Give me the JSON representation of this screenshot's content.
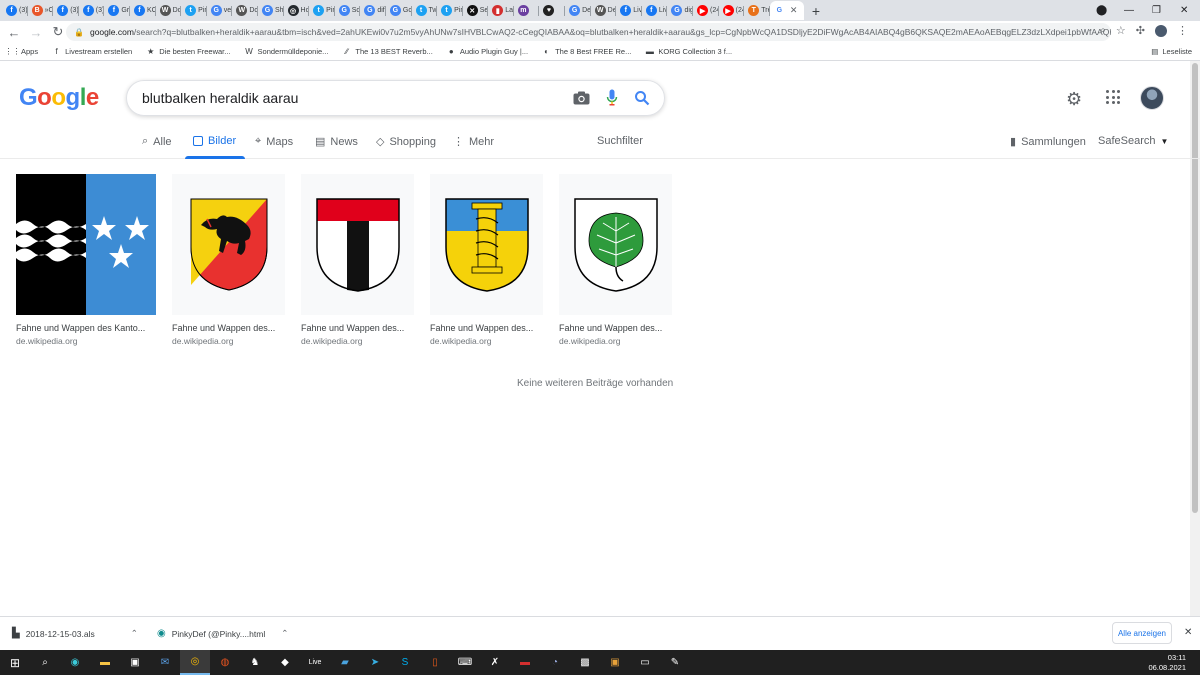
{
  "browser": {
    "tabs": [
      {
        "label": "(3)",
        "color": "#1877f2",
        "glyph": "f"
      },
      {
        "label": "»C",
        "color": "#e8562a",
        "glyph": "B"
      },
      {
        "label": "(3)",
        "color": "#1877f2",
        "glyph": "f"
      },
      {
        "label": "(3)",
        "color": "#1877f2",
        "glyph": "f"
      },
      {
        "label": "Gr",
        "color": "#1877f2",
        "glyph": "f"
      },
      {
        "label": "KC",
        "color": "#1877f2",
        "glyph": "f"
      },
      {
        "label": "Dc",
        "color": "#555",
        "glyph": "W"
      },
      {
        "label": "Pir",
        "color": "#1da1f2",
        "glyph": "t"
      },
      {
        "label": "ver",
        "color": "#4285f4",
        "glyph": "G"
      },
      {
        "label": "Dc",
        "color": "#555",
        "glyph": "W"
      },
      {
        "label": "Sh",
        "color": "#4285f4",
        "glyph": "G"
      },
      {
        "label": "Hc",
        "color": "#24292e",
        "glyph": "◎"
      },
      {
        "label": "Pir",
        "color": "#1da1f2",
        "glyph": "t"
      },
      {
        "label": "So",
        "color": "#4285f4",
        "glyph": "G"
      },
      {
        "label": "dif",
        "color": "#4285f4",
        "glyph": "G"
      },
      {
        "label": "Gc",
        "color": "#4285f4",
        "glyph": "G"
      },
      {
        "label": "Tw",
        "color": "#1da1f2",
        "glyph": "t"
      },
      {
        "label": "Pir",
        "color": "#1da1f2",
        "glyph": "t"
      },
      {
        "label": "Se",
        "color": "#111",
        "glyph": "✕"
      },
      {
        "label": "La",
        "color": "#d32f2f",
        "glyph": "▮"
      },
      {
        "label": "",
        "color": "#6a3fa0",
        "glyph": "m"
      },
      {
        "label": "",
        "color": "#222",
        "glyph": "♥"
      },
      {
        "label": "De",
        "color": "#4285f4",
        "glyph": "G"
      },
      {
        "label": "De",
        "color": "#555",
        "glyph": "W"
      },
      {
        "label": "Liv",
        "color": "#1877f2",
        "glyph": "f"
      },
      {
        "label": "Liv",
        "color": "#1877f2",
        "glyph": "f"
      },
      {
        "label": "dig",
        "color": "#4285f4",
        "glyph": "G"
      },
      {
        "label": "(24",
        "color": "#ff0000",
        "glyph": "▶"
      },
      {
        "label": "(24",
        "color": "#ff0000",
        "glyph": "▶"
      },
      {
        "label": "Tre",
        "color": "#e8711a",
        "glyph": "T"
      }
    ],
    "active_tab": {
      "glyph": "G",
      "close": "✕"
    },
    "new_tab": "+",
    "url_domain": "google.com",
    "url_path": "/search?q=blutbalken+heraldik+aarau&tbm=isch&ved=2ahUKEwi0v7u2m5vyAhUNw7sIHVBLCwAQ2-cCegQIABAA&oq=blutbalken+heraldik+aarau&gs_lcp=CgNpbWcQA1DSDljyE2DiFWgAcAB4AIABQ4gB6QKSAQE2mAEAoAEBqgELZ3dzLXdpei1pbWfAAQE",
    "bookmarks": [
      {
        "label": "Apps",
        "icon": "⋮⋮"
      },
      {
        "label": "Livestream erstellen",
        "icon": "f"
      },
      {
        "label": "Die besten Freewar...",
        "icon": "★"
      },
      {
        "label": "Sondermülldeponie...",
        "icon": "W"
      },
      {
        "label": "The 13 BEST Reverb...",
        "icon": "∕∕"
      },
      {
        "label": "Audio Plugin Guy |...",
        "icon": "●"
      },
      {
        "label": "The 8 Best FREE Re...",
        "icon": "◐"
      },
      {
        "label": "KORG Collection 3 f...",
        "icon": "▬"
      }
    ],
    "reading_list": "Leseliste"
  },
  "google": {
    "logo": [
      {
        "ch": "G",
        "color": "#4285f4"
      },
      {
        "ch": "o",
        "color": "#ea4335"
      },
      {
        "ch": "o",
        "color": "#fbbc05"
      },
      {
        "ch": "g",
        "color": "#4285f4"
      },
      {
        "ch": "l",
        "color": "#34a853"
      },
      {
        "ch": "e",
        "color": "#ea4335"
      }
    ],
    "query": "blutbalken heraldik aarau",
    "tabs": {
      "all": "Alle",
      "images": "Bilder",
      "maps": "Maps",
      "news": "News",
      "shopping": "Shopping",
      "more": "Mehr"
    },
    "filter": "Suchfilter",
    "collections": "Sammlungen",
    "safesearch": "SafeSearch",
    "results": [
      {
        "caption": "Fahne und Wappen des Kanto...",
        "source": "de.wikipedia.org",
        "kind": "flag-aargau"
      },
      {
        "caption": "Fahne und Wappen des...",
        "source": "de.wikipedia.org",
        "kind": "bern"
      },
      {
        "caption": "Fahne und Wappen des...",
        "source": "de.wikipedia.org",
        "kind": "red-black"
      },
      {
        "caption": "Fahne und Wappen des...",
        "source": "de.wikipedia.org",
        "kind": "column"
      },
      {
        "caption": "Fahne und Wappen des...",
        "source": "de.wikipedia.org",
        "kind": "linden"
      }
    ],
    "no_more": "Keine weiteren Beiträge vorhanden"
  },
  "downloads": {
    "items": [
      {
        "name": "2018-12-15-03.als"
      },
      {
        "name": "PinkyDef (@Pinky....html"
      }
    ],
    "show_all": "Alle anzeigen"
  },
  "taskbar": {
    "time": "03:11",
    "date": "06.08.2021"
  }
}
